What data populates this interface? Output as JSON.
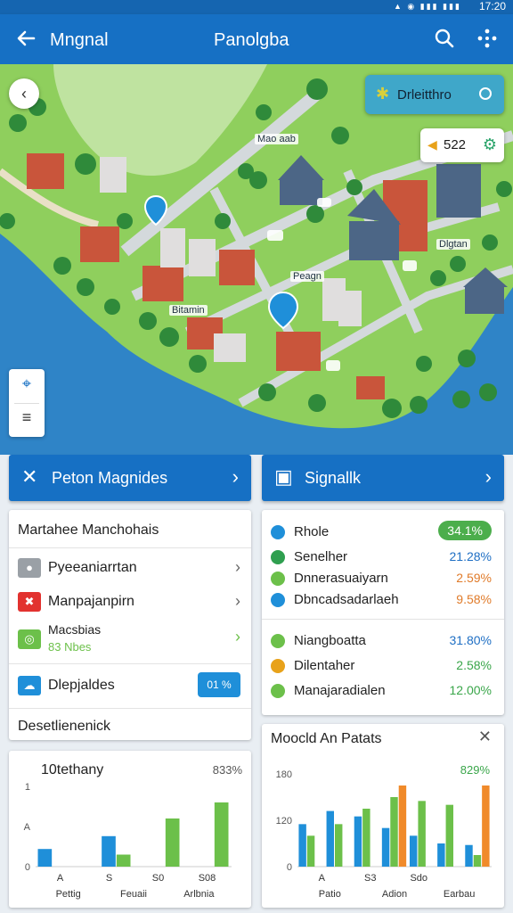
{
  "status_bar": {
    "time": "17:20",
    "indicators": "▲ ◉ ▮▮▮ ▮▮▮"
  },
  "app_bar": {
    "title": "Mngnal",
    "center_title": "Panolgba",
    "back_icon": "arrow-left-icon",
    "search_icon": "search-icon",
    "more_icon": "more-icon"
  },
  "map": {
    "chip_label": "Drleitthro",
    "score": "522",
    "labels": {
      "a": "Mao aab",
      "b": "Dlgtan",
      "c": "Peagn",
      "d": "Bitamin"
    },
    "colors": {
      "water": "#2f84c7",
      "land": "#8fcf5d",
      "road": "#d4d9dc"
    }
  },
  "actions": {
    "left": {
      "label": "Peton Magnides",
      "icon": "close-icon"
    },
    "right": {
      "label": "Signallk",
      "icon": "calendar-icon"
    }
  },
  "left_card": {
    "title": "Martahee Manchohais",
    "items": [
      {
        "label": "Pyeeaniarrtan",
        "color": "#9aa0a6"
      },
      {
        "label": "Manpajanpirn",
        "color": "#e2322f"
      },
      {
        "label": "Macsbias",
        "sub": "83 Nbes",
        "color": "#6cc04a"
      }
    ],
    "chip_row": {
      "label": "Dlepjaldes",
      "chip": "01 %"
    },
    "footer": "Desetlienenick"
  },
  "right_card": {
    "rows": [
      {
        "label": "Rhole",
        "value": "34.1%",
        "dot": "#1f8fd9",
        "val_color": "#ffffff",
        "pill": true
      },
      {
        "label": "Senelher",
        "value": "21.28%",
        "dot": "#2f9f4f",
        "val_color": "#1f6fc4"
      },
      {
        "label": "Dnnerasuaiyarn",
        "value": "2.59%",
        "dot": "#6cc04a",
        "val_color": "#e07b2a"
      },
      {
        "label": "Dbncadsadarlaeh",
        "value": "9.58%",
        "dot": "#1f8fd9",
        "val_color": "#e07b2a"
      },
      {
        "label": "Niangboatta",
        "value": "31.80%",
        "dot": "#6cc04a",
        "val_color": "#1f6fc4"
      },
      {
        "label": "Dilentaher",
        "value": "2.58%",
        "dot": "#e8a21a",
        "val_color": "#3aa64a"
      },
      {
        "label": "Manajaradialen",
        "value": "12.00%",
        "dot": "#6cc04a",
        "val_color": "#3aa64a"
      }
    ]
  },
  "bottom_right_header": {
    "title": "Moocld An Patats",
    "close_icon": "close-icon"
  },
  "chart_data": [
    {
      "type": "bar",
      "title": "10tethany",
      "subtitle": "833%",
      "y_ticks": [
        "0",
        "A",
        "1"
      ],
      "categories": [
        "A",
        "S",
        "S0",
        "S08"
      ],
      "bottom_labels": [
        "Pettig",
        "Feuaii",
        "Arlbnia"
      ],
      "series": [
        {
          "color": "#1f8fd9",
          "values": [
            22,
            0,
            0,
            0
          ]
        },
        {
          "color": "#1f8fd9",
          "values": [
            0,
            38,
            0,
            0
          ]
        },
        {
          "color": "#6cc04a",
          "values": [
            0,
            15,
            60,
            80
          ]
        }
      ],
      "ylim": [
        0,
        100
      ]
    },
    {
      "type": "bar",
      "subtitle": "829%",
      "y_ticks": [
        "0",
        "120",
        "180"
      ],
      "categories": [
        "A",
        "S3",
        "Sdo",
        ""
      ],
      "bottom_labels": [
        "Patio",
        "Adion",
        "Earbau"
      ],
      "series": [
        {
          "color": "#1f8fd9",
          "values": [
            55,
            72,
            65,
            50,
            40,
            30,
            28
          ]
        },
        {
          "color": "#6cc04a",
          "values": [
            40,
            55,
            75,
            90,
            85,
            80,
            15
          ]
        },
        {
          "color": "#f08a2a",
          "values": [
            0,
            0,
            0,
            105,
            0,
            0,
            105
          ]
        }
      ],
      "ylim": [
        0,
        120
      ]
    }
  ]
}
